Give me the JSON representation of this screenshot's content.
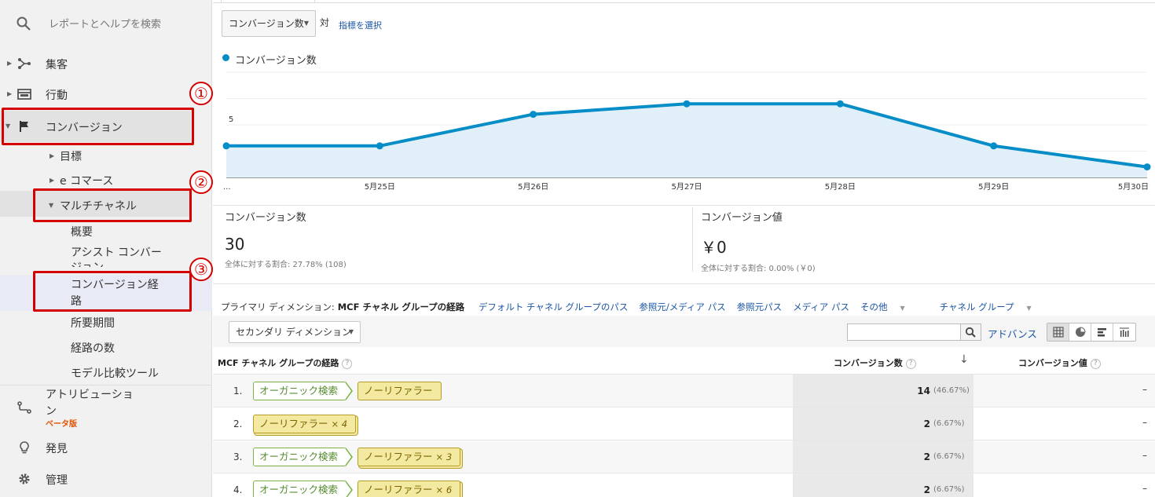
{
  "sidebar": {
    "search_placeholder": "レポートとヘルプを検索",
    "items": [
      {
        "label": "集客",
        "icon": "acquisition-icon"
      },
      {
        "label": "行動",
        "icon": "behavior-icon"
      },
      {
        "label": "コンバージョン",
        "icon": "flag-icon"
      },
      {
        "label": "アトリビューション",
        "icon": "attribution-icon"
      },
      {
        "label": "発見",
        "icon": "lightbulb-icon"
      },
      {
        "label": "管理",
        "icon": "gear-icon"
      }
    ],
    "attribution_label_line1": "アトリビューショ",
    "attribution_label_line2": "ン",
    "beta": "ベータ版",
    "conversion_sub": {
      "goals": "目標",
      "ecommerce": "e コマース",
      "multichannel": "マルチチャネル",
      "mc_items": {
        "overview": "概要",
        "assisted_line1": "アシスト コンバー",
        "assisted_line2": "ジョン",
        "paths_line1": "コンバージョン経",
        "paths_line2": "路",
        "time_lag": "所要期間",
        "path_length": "経路の数",
        "model_tool": "モデル比較ツール"
      }
    },
    "annotations": [
      "①",
      "②",
      "③"
    ]
  },
  "controls": {
    "metric_dropdown": "コンバージョン数",
    "vs": "対",
    "select_metric": "指標を選択"
  },
  "chart_data": {
    "type": "area",
    "series": [
      {
        "name": "コンバージョン数",
        "values": [
          3,
          3,
          6,
          7,
          7,
          3,
          1
        ]
      }
    ],
    "x": [
      "...",
      "5月25日",
      "5月26日",
      "5月27日",
      "5月28日",
      "5月29日",
      "5月30日"
    ],
    "yticks": [
      "10",
      "5"
    ],
    "ylim": [
      0,
      10
    ],
    "color": "#058dc7"
  },
  "kpis": [
    {
      "label": "コンバージョン数",
      "value": "30",
      "sub": "全体に対する割合: 27.78% (108)"
    },
    {
      "label": "コンバージョン値",
      "value": "￥0",
      "sub": "全体に対する割合: 0.00% (￥0)"
    }
  ],
  "dimensions": {
    "primary_label": "プライマリ ディメンション:",
    "primary_value": "MCF チャネル グループの経路",
    "options": [
      "デフォルト チャネル グループのパス",
      "参照元/メディア パス",
      "参照元パス",
      "メディア パス"
    ],
    "other": "その他",
    "channel_group": "チャネル グループ",
    "secondary": "セカンダリ ディメンション",
    "advanced": "アドバンス"
  },
  "table": {
    "headers": [
      "MCF チャネル グループの経路",
      "コンバージョン数",
      "コンバージョン値"
    ],
    "help": "?",
    "sort": "↓",
    "rows": [
      {
        "idx": "1.",
        "chips": [
          {
            "type": "organic",
            "label": "オーガニック検索",
            "mult": ""
          },
          {
            "type": "referral",
            "label": "ノーリファラー",
            "mult": ""
          }
        ],
        "value": "14",
        "pct": "(46.67%)",
        "cv": "–"
      },
      {
        "idx": "2.",
        "chips": [
          {
            "type": "referral",
            "label": "ノーリファラー",
            "mult": "× 4"
          }
        ],
        "value": "2",
        "pct": "(6.67%)",
        "cv": "–"
      },
      {
        "idx": "3.",
        "chips": [
          {
            "type": "organic",
            "label": "オーガニック検索",
            "mult": ""
          },
          {
            "type": "referral",
            "label": "ノーリファラー",
            "mult": "× 3"
          }
        ],
        "value": "2",
        "pct": "(6.67%)",
        "cv": "–"
      },
      {
        "idx": "4.",
        "chips": [
          {
            "type": "organic",
            "label": "オーガニック検索",
            "mult": ""
          },
          {
            "type": "referral",
            "label": "ノーリファラー",
            "mult": "× 6"
          }
        ],
        "value": "2",
        "pct": "(6.67%)",
        "cv": "–"
      }
    ]
  }
}
